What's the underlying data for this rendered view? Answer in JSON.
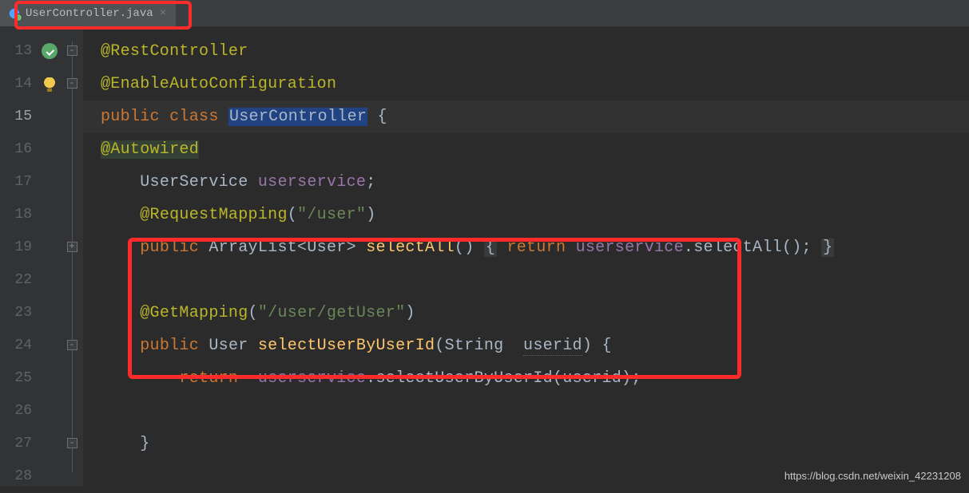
{
  "tab": {
    "filename": "UserController.java",
    "close_glyph": "×"
  },
  "gutter": {
    "line_numbers": [
      "13",
      "14",
      "15",
      "16",
      "17",
      "18",
      "19",
      "22",
      "23",
      "24",
      "25",
      "26",
      "27",
      "28"
    ],
    "fold_marks": [
      "-",
      "-",
      "",
      "",
      "",
      "",
      "+",
      "",
      "",
      "-",
      "",
      "",
      "-",
      ""
    ],
    "icons": [
      "green-badge",
      "bulb",
      "",
      "",
      "",
      "",
      "",
      "",
      "",
      "",
      "",
      "",
      "",
      ""
    ]
  },
  "code": {
    "l13": {
      "ann": "@RestController"
    },
    "l14": {
      "ann": "@EnableAutoConfiguration"
    },
    "l15": {
      "kw1": "public",
      "kw2": "class",
      "name": "UserController",
      "brace": "{"
    },
    "l16": {
      "ann": "@Autowired"
    },
    "l17": {
      "type": "UserService",
      "var": "userservice",
      "semi": ";"
    },
    "l18": {
      "ann": "@RequestMapping",
      "lp": "(",
      "str": "\"/user\"",
      "rp": ")"
    },
    "l19": {
      "kw": "public",
      "type": "ArrayList<User>",
      "mtd": "selectAll",
      "par": "()",
      "ob": "{",
      "ret": "return",
      "svc": "userservice",
      "dot": ".",
      "call": "selectAll",
      "call_p": "();",
      "cb": "}"
    },
    "l23": {
      "ann": "@GetMapping",
      "lp": "(",
      "str": "\"/user/getUser\"",
      "rp": ")"
    },
    "l24": {
      "kw": "public",
      "type": "User",
      "mtd": "selectUserByUserId",
      "lp": "(",
      "ptype": "String",
      "pname": "userid",
      "rp": ")",
      "brace": "{"
    },
    "l25": {
      "ret": "return",
      "svc": "userservice",
      "dot": ".",
      "call": "selectUserByUserId",
      "lp": "(",
      "arg": "userid",
      "rp": ");"
    },
    "l27": {
      "brace": "}"
    }
  },
  "watermark": "https://blog.csdn.net/weixin_42231208"
}
